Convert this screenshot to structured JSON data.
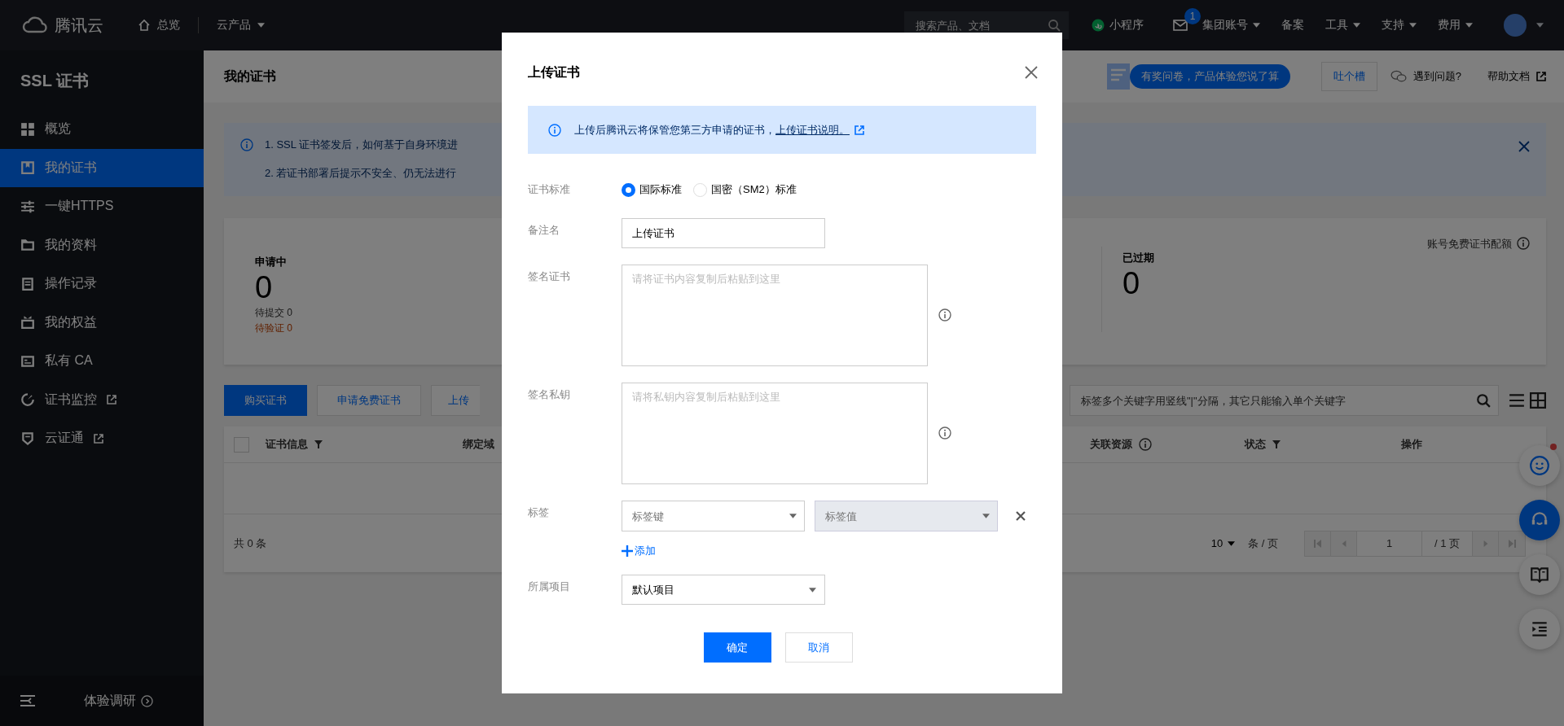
{
  "topbar": {
    "logo": "腾讯云",
    "nav": [
      {
        "label": "总览",
        "kind": "home"
      },
      {
        "label": "云产品",
        "kind": "dropdown"
      }
    ],
    "search": {
      "placeholder": "搜索产品、文档"
    },
    "mini_program": "小程序",
    "mail": {
      "badge": "1"
    },
    "links": [
      {
        "label": "集团账号",
        "dropdown": true
      },
      {
        "label": "备案",
        "dropdown": false
      },
      {
        "label": "工具",
        "dropdown": true
      },
      {
        "label": "支持",
        "dropdown": true
      },
      {
        "label": "费用",
        "dropdown": true
      }
    ]
  },
  "sidebar": {
    "title": "SSL 证书",
    "items": [
      {
        "label": "概览",
        "kind": "grid",
        "selected": false,
        "external": false
      },
      {
        "label": "我的证书",
        "kind": "cert",
        "selected": true,
        "external": false
      },
      {
        "label": "一键HTTPS",
        "kind": "sliders",
        "selected": false,
        "external": false
      },
      {
        "label": "我的资料",
        "kind": "folder",
        "selected": false,
        "external": false
      },
      {
        "label": "操作记录",
        "kind": "doc",
        "selected": false,
        "external": false
      },
      {
        "label": "我的权益",
        "kind": "gift",
        "selected": false,
        "external": false
      },
      {
        "label": "私有 CA",
        "kind": "ca",
        "selected": false,
        "external": false
      },
      {
        "label": "证书监控",
        "kind": "monitor",
        "selected": false,
        "external": true
      },
      {
        "label": "云证通",
        "kind": "shield",
        "selected": false,
        "external": true
      }
    ],
    "footer": "体验调研"
  },
  "header": {
    "title": "我的证书",
    "survey": "有奖问卷，产品体验您说了算",
    "feedback": "吐个槽",
    "help": "遇到问题?",
    "docs": "帮助文档"
  },
  "notice": {
    "lines": [
      "1. SSL 证书签发后，如何基于自身环境进",
      "2. 若证书部署后提示不安全、仍无法进行"
    ]
  },
  "stats": {
    "groups": [
      {
        "title": "申请中",
        "value": "0",
        "details": [
          {
            "label": "待提交 0",
            "kind": "normal"
          },
          {
            "label": "待验证 0",
            "kind": "warning"
          }
        ]
      },
      {
        "title": "已过期",
        "value": "0"
      }
    ],
    "quota": "账号免费证书配额"
  },
  "toolbar": {
    "buttons": [
      {
        "label": "购买证书",
        "primary": true
      },
      {
        "label": "申请免费证书",
        "primary": false
      },
      {
        "label": "上传",
        "primary": false
      }
    ],
    "search": {
      "placeholder": "标签多个关键字用竖线\"|\"分隔，其它只能输入单个关键字"
    }
  },
  "table": {
    "columns": [
      {
        "label": "证书信息",
        "kind": "filter"
      },
      {
        "label": "绑定域",
        "kind": "plain"
      },
      {
        "label": "关联资源",
        "kind": "info"
      },
      {
        "label": "状态",
        "kind": "filter"
      },
      {
        "label": "操作",
        "kind": "plain"
      }
    ],
    "select_all_checked": false,
    "total": "共 0 条",
    "page_size": "10",
    "per_page": "条 / 页",
    "page": "1",
    "pages": "/ 1 页"
  },
  "floating": [
    {
      "kind": "smile",
      "dot": true
    },
    {
      "kind": "headset",
      "dot": false
    },
    {
      "kind": "book",
      "dot": false
    },
    {
      "kind": "outline",
      "dot": false
    }
  ],
  "dialog": {
    "title": "上传证书",
    "info": {
      "text": "上传后腾讯云将保管您第三方申请的证书，",
      "link": "上传证书说明。"
    },
    "fields": [
      {
        "label": "证书标准",
        "kind": "radio",
        "options": [
          {
            "label": "国际标准",
            "selected": true
          },
          {
            "label": "国密（SM2）标准",
            "selected": false
          }
        ]
      },
      {
        "label": "备注名",
        "kind": "input",
        "value": "上传证书"
      },
      {
        "label": "签名证书",
        "kind": "textarea",
        "placeholder": "请将证书内容复制后粘贴到这里"
      },
      {
        "label": "签名私钥",
        "kind": "textarea",
        "placeholder": "请将私钥内容复制后粘贴到这里"
      },
      {
        "label": "标签",
        "kind": "tags",
        "key_placeholder": "标签键",
        "value_placeholder": "标签值",
        "add": "添加"
      },
      {
        "label": "所属项目",
        "kind": "select",
        "value": "默认项目"
      }
    ],
    "buttons": [
      {
        "label": "确定",
        "primary": true
      },
      {
        "label": "取消",
        "primary": false
      }
    ]
  }
}
